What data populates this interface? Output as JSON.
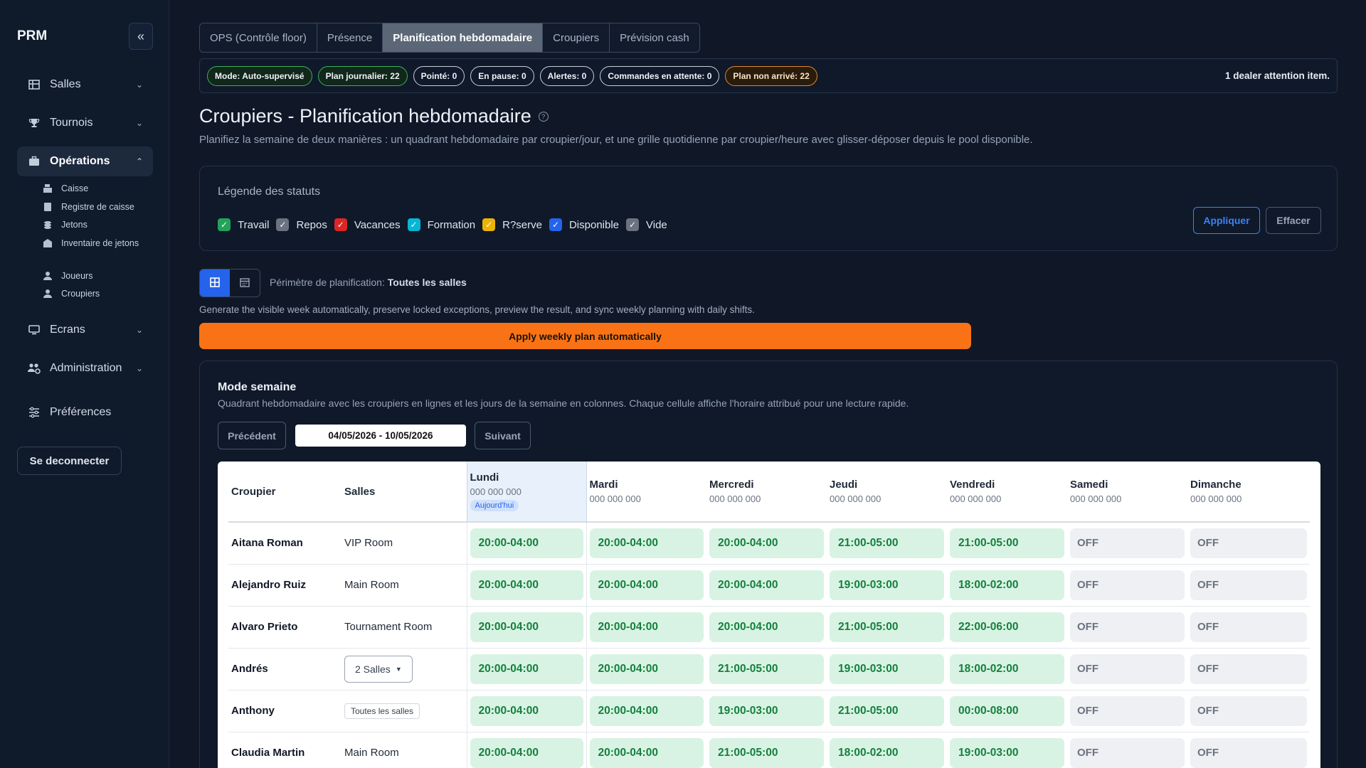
{
  "sidebar": {
    "brand": "PRM",
    "items": [
      {
        "label": "Salles"
      },
      {
        "label": "Tournois"
      },
      {
        "label": "Opérations"
      },
      {
        "label": "Ecrans"
      },
      {
        "label": "Administration"
      },
      {
        "label": "Préférences"
      }
    ],
    "sub_items": [
      "Caisse",
      "Registre de caisse",
      "Jetons",
      "Inventaire de jetons",
      "Joueurs",
      "Croupiers"
    ],
    "logout": "Se deconnecter"
  },
  "tabs": [
    "OPS (Contrôle floor)",
    "Présence",
    "Planification hebdomadaire",
    "Croupiers",
    "Prévision cash"
  ],
  "statusbar": {
    "chips": [
      "Mode: Auto-supervisé",
      "Plan journalier: 22",
      "Pointé: 0",
      "En pause: 0",
      "Alertes: 0",
      "Commandes en attente: 0",
      "Plan non arrivé: 22"
    ],
    "right_text": "1 dealer attention item."
  },
  "page": {
    "title": "Croupiers - Planification hebdomadaire",
    "subtitle": "Planifiez la semaine de deux manières : un quadrant hebdomadaire par croupier/jour, et une grille quotidienne par croupier/heure avec glisser-déposer depuis le pool disponible."
  },
  "legend": {
    "title": "Légende des statuts",
    "items": [
      {
        "label": "Travail",
        "color": "#22a35a"
      },
      {
        "label": "Repos",
        "color": "#6b7280"
      },
      {
        "label": "Vacances",
        "color": "#dc2626"
      },
      {
        "label": "Formation",
        "color": "#06b6d4"
      },
      {
        "label": "R?serve",
        "color": "#eab308"
      },
      {
        "label": "Disponible",
        "color": "#2563eb"
      },
      {
        "label": "Vide",
        "color": "#6b7280"
      }
    ],
    "apply": "Appliquer",
    "clear": "Effacer"
  },
  "scope": {
    "label": "Périmètre de planification:",
    "value": "Toutes les salles"
  },
  "generate_text": "Generate the visible week automatically, preserve locked exceptions, preview the result, and sync weekly planning with daily shifts.",
  "auto_button": "Apply weekly plan automatically",
  "week": {
    "title": "Mode semaine",
    "subtitle": "Quadrant hebdomadaire avec les croupiers en lignes et les jours de la semaine en colonnes. Chaque cellule affiche l'horaire attribué pour une lecture rapide.",
    "prev": "Précédent",
    "next": "Suivant",
    "range": "04/05/2026 - 10/05/2026",
    "col_dealer": "Croupier",
    "col_rooms": "Salles",
    "today_badge": "Aujourd'hui",
    "days": [
      {
        "name": "Lundi",
        "date": "000 000 000"
      },
      {
        "name": "Mardi",
        "date": "000 000 000"
      },
      {
        "name": "Mercredi",
        "date": "000 000 000"
      },
      {
        "name": "Jeudi",
        "date": "000 000 000"
      },
      {
        "name": "Vendredi",
        "date": "000 000 000"
      },
      {
        "name": "Samedi",
        "date": "000 000 000"
      },
      {
        "name": "Dimanche",
        "date": "000 000 000"
      }
    ],
    "rows": [
      {
        "name": "Aitana Roman",
        "room": "VIP Room",
        "room_type": "text",
        "shifts": [
          "20:00-04:00",
          "20:00-04:00",
          "20:00-04:00",
          "21:00-05:00",
          "21:00-05:00",
          "OFF",
          "OFF"
        ]
      },
      {
        "name": "Alejandro Ruiz",
        "room": "Main Room",
        "room_type": "text",
        "shifts": [
          "20:00-04:00",
          "20:00-04:00",
          "20:00-04:00",
          "19:00-03:00",
          "18:00-02:00",
          "OFF",
          "OFF"
        ]
      },
      {
        "name": "Alvaro Prieto",
        "room": "Tournament Room",
        "room_type": "text",
        "shifts": [
          "20:00-04:00",
          "20:00-04:00",
          "20:00-04:00",
          "21:00-05:00",
          "22:00-06:00",
          "OFF",
          "OFF"
        ]
      },
      {
        "name": "Andrés",
        "room": "2 Salles",
        "room_type": "dropdown",
        "shifts": [
          "20:00-04:00",
          "20:00-04:00",
          "21:00-05:00",
          "19:00-03:00",
          "18:00-02:00",
          "OFF",
          "OFF"
        ]
      },
      {
        "name": "Anthony",
        "room": "Toutes les salles",
        "room_type": "chip",
        "shifts": [
          "20:00-04:00",
          "20:00-04:00",
          "19:00-03:00",
          "21:00-05:00",
          "00:00-08:00",
          "OFF",
          "OFF"
        ]
      },
      {
        "name": "Claudia Martin",
        "room": "Main Room",
        "room_type": "text",
        "shifts": [
          "20:00-04:00",
          "20:00-04:00",
          "21:00-05:00",
          "18:00-02:00",
          "19:00-03:00",
          "OFF",
          "OFF"
        ]
      }
    ]
  }
}
